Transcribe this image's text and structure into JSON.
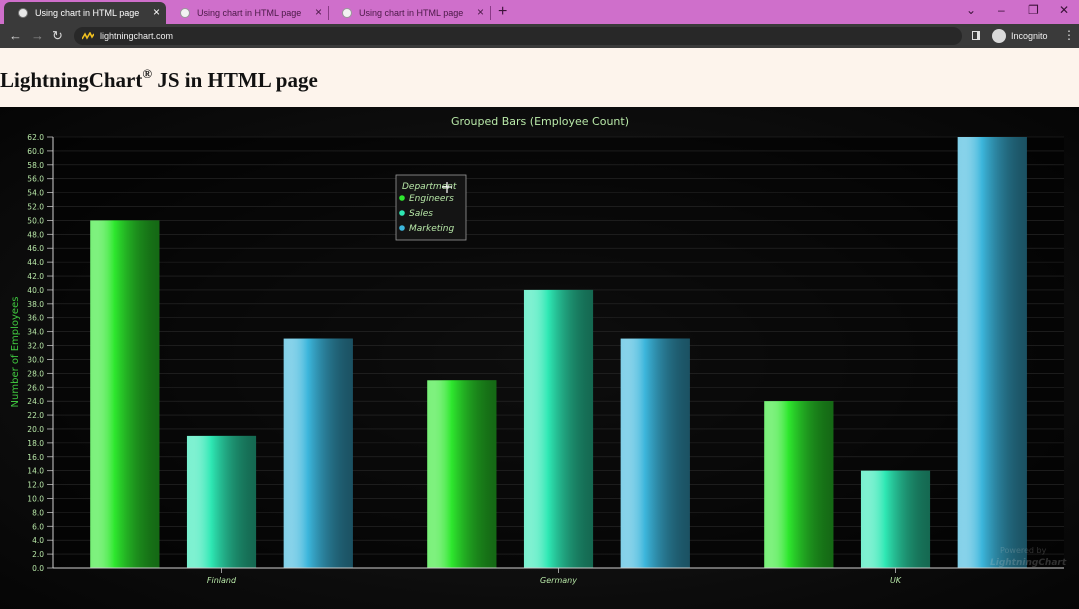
{
  "browser": {
    "tabs": [
      {
        "title": "Using chart in HTML page",
        "active": true
      },
      {
        "title": "Using chart in HTML page",
        "active": false
      },
      {
        "title": "Using chart in HTML page",
        "active": false
      }
    ],
    "new_tab": "+",
    "window_controls": {
      "dropdown": "⌄",
      "minimize": "–",
      "restore": "❐",
      "close": "✕"
    },
    "nav": {
      "back": "←",
      "forward": "→",
      "reload": "↻"
    },
    "url": "lightningchart.com",
    "profile_label": "Incognito",
    "menu": "⋮"
  },
  "page": {
    "heading_main": "LightningChart",
    "heading_reg": "®",
    "heading_rest": " JS in HTML page"
  },
  "chart_data": {
    "type": "bar",
    "title": "Grouped Bars (Employee Count)",
    "ylabel": "Number of Employees",
    "xlabel": "",
    "categories": [
      "Finland",
      "Germany",
      "UK"
    ],
    "series": [
      {
        "name": "Engineers",
        "values": [
          50,
          27,
          24
        ],
        "color": "#2ee82e"
      },
      {
        "name": "Sales",
        "values": [
          19,
          40,
          14
        ],
        "color": "#2ee8b4"
      },
      {
        "name": "Marketing",
        "values": [
          33,
          33,
          62
        ],
        "color": "#3cb6dc"
      }
    ],
    "ylim": [
      0,
      62
    ],
    "ytick_step": 2,
    "legend": {
      "title": "Department",
      "placement": "top-center"
    },
    "watermark": {
      "line1": "Powered by",
      "line2": "LightningChart"
    },
    "text_color": "#b8e8a8",
    "grid": true
  }
}
